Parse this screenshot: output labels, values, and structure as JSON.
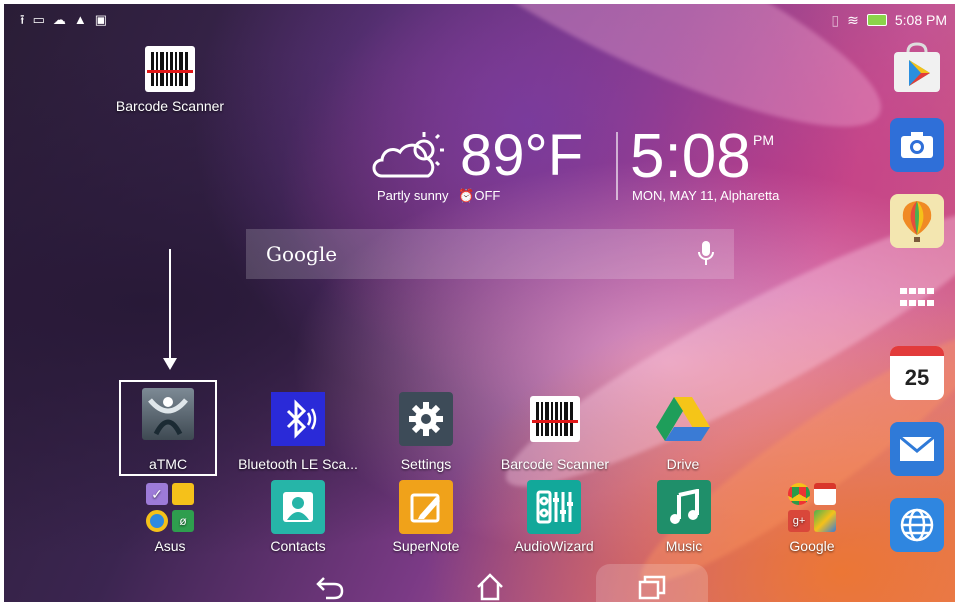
{
  "status_bar": {
    "left_icons": [
      "upload-icon",
      "image-icon",
      "cloud-icon",
      "warning-icon",
      "sim-icon"
    ],
    "time": "5:08 PM"
  },
  "top_app": {
    "label": "Barcode Scanner",
    "icon": "barcode-icon"
  },
  "clock_widget": {
    "temperature": "89°F",
    "weather": "Partly sunny",
    "alarm": "OFF",
    "time": "5:08",
    "ampm": "PM",
    "date": "MON, MAY 11, Alpharetta"
  },
  "search": {
    "placeholder": "Google"
  },
  "apps_row1": [
    {
      "label": "aTMC",
      "icon": "atmc-icon",
      "color": "#4a5560"
    },
    {
      "label": "Bluetooth LE Sca...",
      "icon": "bluetooth-icon",
      "color": "#2a2ad8"
    },
    {
      "label": "Settings",
      "icon": "gear-icon",
      "color": "#3a4a5a"
    },
    {
      "label": "Barcode Scanner",
      "icon": "barcode-icon",
      "color": "#ffffff"
    },
    {
      "label": "Drive",
      "icon": "drive-icon",
      "color": "#ffffff"
    }
  ],
  "apps_row2": [
    {
      "label": "Asus",
      "icon": "folder-icon"
    },
    {
      "label": "Contacts",
      "icon": "contacts-icon",
      "color": "#26b5a8"
    },
    {
      "label": "SuperNote",
      "icon": "pencil-icon",
      "color": "#f0a21a"
    },
    {
      "label": "AudioWizard",
      "icon": "equalizer-icon",
      "color": "#12a89a"
    },
    {
      "label": "Music",
      "icon": "music-icon",
      "color": "#1f8f6a"
    },
    {
      "label": "Google",
      "icon": "folder-icon"
    }
  ],
  "dock": [
    {
      "icon": "play-store-icon"
    },
    {
      "icon": "camera-icon",
      "color": "#2f6fd8"
    },
    {
      "icon": "balloon-icon",
      "color": "#f3e6b0"
    },
    {
      "icon": "all-apps-icon"
    },
    {
      "icon": "calendar-icon",
      "day": "25"
    },
    {
      "icon": "email-icon",
      "color": "#2f7ad8"
    },
    {
      "icon": "browser-icon",
      "color": "#2f86e0"
    }
  ],
  "nav": {
    "back": "back-icon",
    "home": "home-icon",
    "recents": "recents-icon"
  }
}
